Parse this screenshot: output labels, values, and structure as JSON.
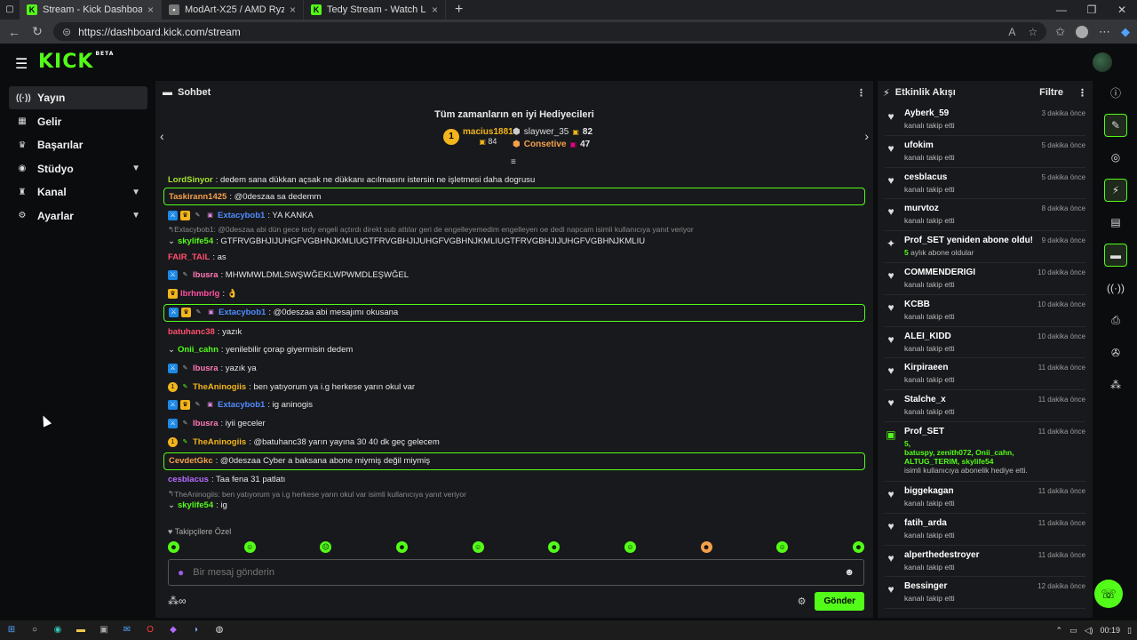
{
  "browser": {
    "tabs": [
      {
        "title": "Stream - Kick Dashboard",
        "active": true
      },
      {
        "title": "ModArt-X25 / AMD Ryzen 5 5600",
        "active": false
      },
      {
        "title": "Tedy Stream - Watch Live on Kick",
        "active": false
      }
    ],
    "url": "https://dashboard.kick.com/stream"
  },
  "brand": {
    "logo": "KICK",
    "tag": "BETA"
  },
  "sidebar": {
    "items": [
      {
        "icon": "((·))",
        "label": "Yayın"
      },
      {
        "icon": "▦",
        "label": "Gelir"
      },
      {
        "icon": "🏆",
        "label": "Başarılar"
      },
      {
        "icon": "◉",
        "label": "Stüdyo"
      },
      {
        "icon": "♜",
        "label": "Kanal"
      },
      {
        "icon": "⚙",
        "label": "Ayarlar"
      }
    ]
  },
  "chat": {
    "title": "Sohbet",
    "gifters_title": "Tüm zamanların en iyi Hediyecileri",
    "top1": {
      "name": "macius1881",
      "count": "84",
      "rank": "1"
    },
    "top2": {
      "name": "slaywer_35",
      "count": "82"
    },
    "top3": {
      "name": "Consetive",
      "count": "47"
    },
    "messages": [
      {
        "user": "LordSinyor",
        "color": "#a6e22e",
        "text": ": dedem sana dükkan açsak ne dükkanı acılmasını istersin ne işletmesi daha dogrusu"
      },
      {
        "user": "Taskirann1425",
        "color": "#f5a04a",
        "text": ": @0deszaa sa dedemm"
      },
      {
        "user": "Extacybob1",
        "color": "#4f8cff",
        "text": ": YA KANKA"
      },
      {
        "user": "skylife54",
        "color": "#53fc18",
        "text": ": GTFRVGBHJIJUHGFVGBHNJKMLIUGTFRVGBHJIJUHGFVGBHNJKMLIUGTFRVGBHJIJUHGFVGBHNJKMLIU",
        "reply": "Extacybob1: @0deszaa abi dün gece tedy engeli açtırdı direkt sub attılar geri de engelleyemedim engelleyen oe dedi napcam isimli kullanıcıya yanıt veriyor"
      },
      {
        "user": "FAIR_TAIL",
        "color": "#ff4f6d",
        "text": ": as"
      },
      {
        "user": "lbusra",
        "color": "#ff7ab6",
        "text": ": MHWMWLDMLSWŞWĞEKLWPWMDLEŞWĞEL"
      },
      {
        "user": "lbrhmbrlg",
        "color": "#ff4f9f",
        "text": ": 👌"
      },
      {
        "user": "Extacybob1",
        "color": "#4f8cff",
        "text": ": @0deszaa abi mesajımı okusana"
      },
      {
        "user": "batuhanc38",
        "color": "#ff4f6d",
        "text": ": yazık"
      },
      {
        "user": "Onii_cahn",
        "color": "#53fc18",
        "text": ": yenilebilir çorap giyermisin dedem"
      },
      {
        "user": "lbusra",
        "color": "#ff7ab6",
        "text": ": yazık ya"
      },
      {
        "user": "TheAninogiis",
        "color": "#f2b51c",
        "text": ": ben yatıyorum ya i.g herkese yarın okul var"
      },
      {
        "user": "Extacybob1",
        "color": "#4f8cff",
        "text": ": ig aninogis"
      },
      {
        "user": "lbusra",
        "color": "#ff7ab6",
        "text": ": iyii geceler"
      },
      {
        "user": "TheAninogiis",
        "color": "#f2b51c",
        "text": ": @batuhanc38 yarın yayına 30 40 dk geç gelecem"
      },
      {
        "user": "CevdetGkc",
        "color": "#f5a04a",
        "text": ": @0deszaa Cyber a baksana abone miymiş değil miymiş"
      },
      {
        "user": "cesblacus",
        "color": "#b46cff",
        "text": ": Taa fena 31 patlatı"
      },
      {
        "user": "skylife54",
        "color": "#53fc18",
        "text": ": ig",
        "reply": "TheAninogiis: ben yatıyorum ya i.g herkese yarın okul var isimli kullanıcıya yanıt veriyor"
      }
    ],
    "followers_label": "Takipçilere Özel",
    "input_placeholder": "Bir mesaj gönderin",
    "send_label": "Gönder"
  },
  "activity": {
    "title": "Etkinlik Akışı",
    "filter_label": "Filtre",
    "items": [
      {
        "name": "Ayberk_59",
        "sub": "kanalı takip etti",
        "time": "3 dakika önce"
      },
      {
        "name": "ufokim",
        "sub": "kanalı takip etti",
        "time": "5 dakika önce"
      },
      {
        "name": "cesblacus",
        "sub": "kanalı takip etti",
        "time": "5 dakika önce"
      },
      {
        "name": "murvtoz",
        "sub": "kanalı takip etti",
        "time": "8 dakika önce"
      },
      {
        "name": "Prof_SET yeniden abone oldu!",
        "sub_g": "5",
        "sub": " aylık abone oldular",
        "time": "9 dakika önce"
      },
      {
        "name": "COMMENDERIGI",
        "sub": "kanalı takip etti",
        "time": "10 dakika önce"
      },
      {
        "name": "KCBB",
        "sub": "kanalı takip etti",
        "time": "10 dakika önce"
      },
      {
        "name": "ALEI_KIDD",
        "sub": "kanalı takip etti",
        "time": "10 dakika önce"
      },
      {
        "name": "Kirpiraeen",
        "sub": "kanalı takip etti",
        "time": "11 dakika önce"
      },
      {
        "name": "Stalche_x",
        "sub": "kanalı takip etti",
        "time": "11 dakika önce"
      },
      {
        "name": "Prof_SET",
        "gift_count": "5,",
        "gift_users": "batuspy, zenith072, Onii_cahn, ALTUG_TERIM, skylife54",
        "sub": "isimli kullanıcıya abonelik hediye etti.",
        "time": "11 dakika önce"
      },
      {
        "name": "biggekagan",
        "sub": "kanalı takip etti",
        "time": "11 dakika önce"
      },
      {
        "name": "fatih_arda",
        "sub": "kanalı takip etti",
        "time": "11 dakika önce"
      },
      {
        "name": "alperthedestroyer",
        "sub": "kanalı takip etti",
        "time": "11 dakika önce"
      },
      {
        "name": "Bessinger",
        "sub": "kanalı takip etti",
        "time": "12 dakika önce"
      }
    ]
  },
  "taskbar": {
    "time": "00:19"
  },
  "colors": {
    "accent": "#53fc18",
    "panel": "#18191c",
    "bg": "#0b0c0e"
  }
}
